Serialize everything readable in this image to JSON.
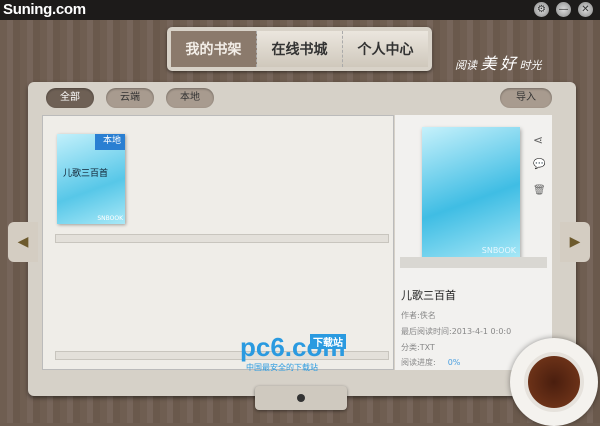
{
  "app": {
    "logo": "Suning.com"
  },
  "window": {
    "settings": "⚙",
    "minimize": "—",
    "close": "✕"
  },
  "tabs": [
    {
      "label": "我的书架"
    },
    {
      "label": "在线书城"
    },
    {
      "label": "个人中心"
    }
  ],
  "slogan": {
    "a": "阅读",
    "b": "美",
    "c": "好",
    "d": "时光"
  },
  "filters": {
    "all": "全部",
    "cloud": "云端",
    "local": "本地",
    "import": "导入"
  },
  "book": {
    "title": "儿歌三百首",
    "badge": "本地",
    "brand": "SNBOOK"
  },
  "detail": {
    "title": "儿歌三百首",
    "author": "作者:佚名",
    "last_read": "最后阅读时间:2013-4-1 0:0:0",
    "category": "分类:TXT",
    "progress_label": "阅读进度:",
    "progress": "0%",
    "cover_brand": "SNBOOK"
  },
  "icons": {
    "share": "⋖",
    "comment": "💬",
    "delete": "🗑",
    "prev": "◀",
    "next": "▶"
  },
  "watermark": {
    "logo": "pc6.com",
    "tag": "下载站",
    "sub": "中国最安全的下载站"
  }
}
